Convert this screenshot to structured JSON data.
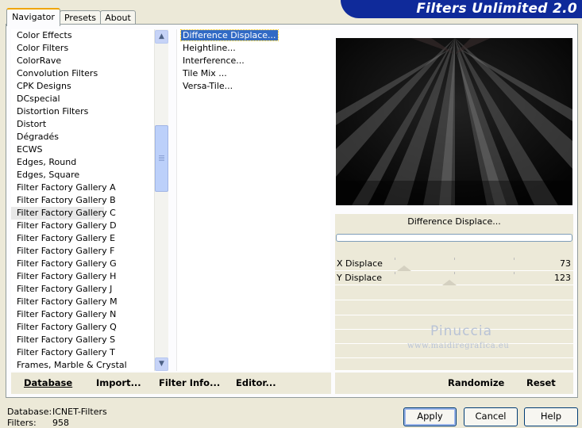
{
  "app": {
    "title": "Filters Unlimited 2.0"
  },
  "tabs": [
    {
      "label": "Navigator",
      "active": true
    },
    {
      "label": "Presets",
      "active": false
    },
    {
      "label": "About",
      "active": false
    }
  ],
  "categories": {
    "items": [
      "Color Effects",
      "Color Filters",
      "ColorRave",
      "Convolution Filters",
      "CPK Designs",
      "DCspecial",
      "Distortion Filters",
      "Distort",
      "Dégradés",
      "ECWS",
      "Edges, Round",
      "Edges, Square",
      "Filter Factory Gallery A",
      "Filter Factory Gallery B",
      "Filter Factory Gallery C",
      "Filter Factory Gallery D",
      "Filter Factory Gallery E",
      "Filter Factory Gallery F",
      "Filter Factory Gallery G",
      "Filter Factory Gallery H",
      "Filter Factory Gallery J",
      "Filter Factory Gallery M",
      "Filter Factory Gallery N",
      "Filter Factory Gallery Q",
      "Filter Factory Gallery S",
      "Filter Factory Gallery T",
      "Frames, Marble & Crystal"
    ],
    "selected": "Filter Factory Gallery C"
  },
  "filters": {
    "items": [
      "Difference Displace...",
      "Heightline...",
      "Interference...",
      "Tile Mix ...",
      "Versa-Tile..."
    ],
    "selected": "Difference Displace..."
  },
  "panel": {
    "filter_name": "Difference Displace...",
    "progress": 0,
    "sliders": [
      {
        "label": "X Displace",
        "value": "73",
        "fraction": 0.29
      },
      {
        "label": "Y Displace",
        "value": "123",
        "fraction": 0.48
      }
    ],
    "watermark": {
      "name": "Pinuccia",
      "url": "www.maidiregrafica.eu"
    }
  },
  "toolbar": {
    "database": "Database",
    "import": "Import...",
    "filter_info": "Filter Info...",
    "editor": "Editor...",
    "randomize": "Randomize",
    "reset": "Reset"
  },
  "status": {
    "database_label": "Database:",
    "database_value": "ICNET-Filters",
    "filters_label": "Filters:",
    "filters_value": "958"
  },
  "buttons": {
    "apply": "Apply",
    "cancel": "Cancel",
    "help": "Help"
  },
  "colors": {
    "banner": "#0f2a9a",
    "selection": "#316ac5",
    "tab_accent": "#f0a500"
  },
  "icons": {
    "scroll_up": "chevron-up-icon",
    "scroll_down": "chevron-down-icon"
  }
}
